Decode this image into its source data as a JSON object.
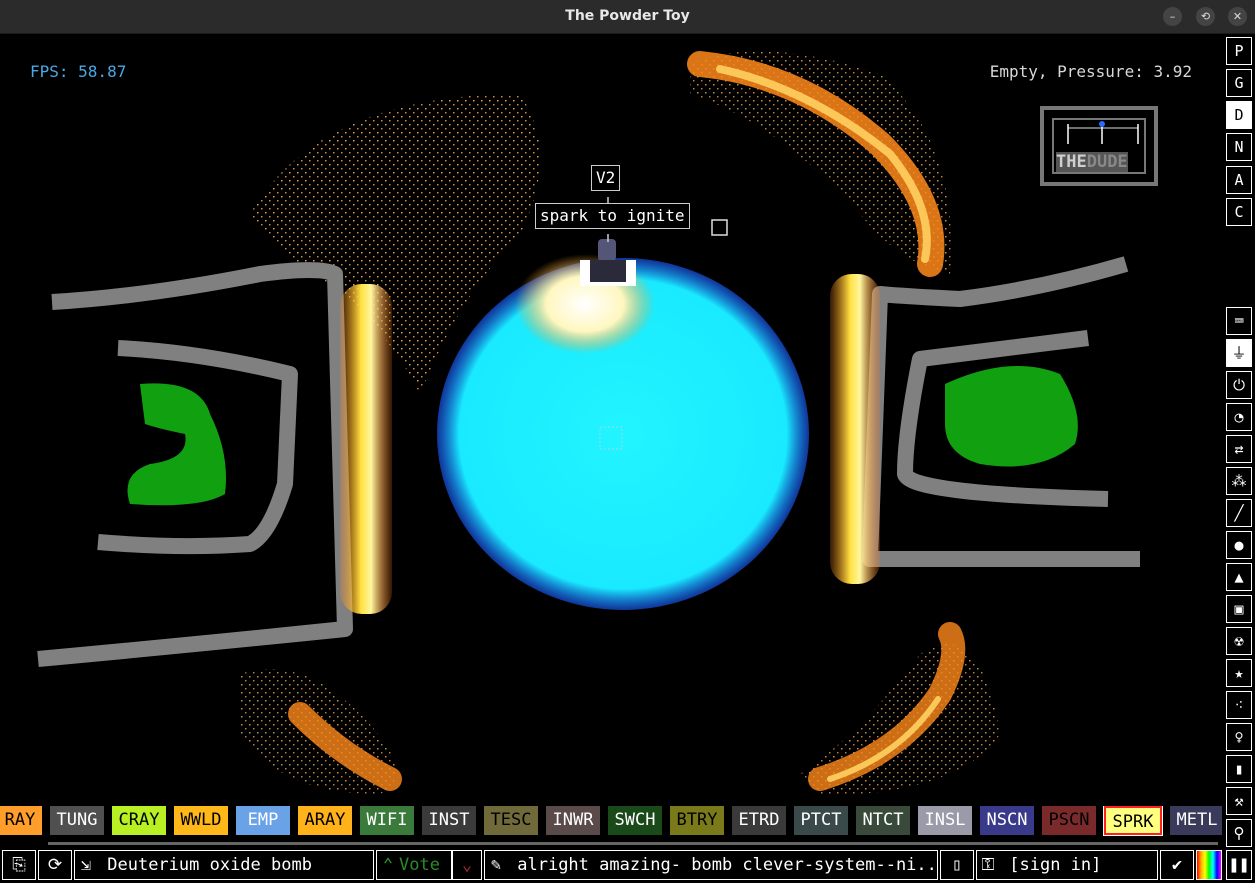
{
  "window": {
    "title": "The Powder Toy",
    "controls": [
      "–",
      "⟲",
      "✕"
    ]
  },
  "hud": {
    "fps": "FPS: 58.87",
    "pressure": "Empty, Pressure: 3.92"
  },
  "signs": {
    "version": "V2",
    "hint": "spark to ignite"
  },
  "stamp": {
    "text_left": "THE",
    "text_right": "DUDE"
  },
  "display_modes": [
    "P",
    "G",
    "D",
    "N",
    "A",
    "C"
  ],
  "display_modes_selected": "D",
  "category_icons": [
    "keyboard-icon",
    "plug-icon",
    "power-icon",
    "gauge-icon",
    "arrows-icon",
    "spray-icon",
    "pen-icon",
    "drop-icon",
    "flask-icon",
    "square-icon",
    "radiation-icon",
    "star-icon",
    "dots-icon",
    "bulb-icon",
    "bookmark-icon",
    "hammer-icon",
    "magnifier-icon"
  ],
  "category_selected": "plug-icon",
  "elements": [
    {
      "label": "RAY",
      "bg": "#ff9e2a",
      "fg": "#000000"
    },
    {
      "label": "TUNG",
      "bg": "#505050",
      "fg": "#ffffff"
    },
    {
      "label": "CRAY",
      "bg": "#b8f024",
      "fg": "#000000"
    },
    {
      "label": "WWLD",
      "bg": "#ffb81a",
      "fg": "#000000"
    },
    {
      "label": "EMP",
      "bg": "#6aa2e8",
      "fg": "#ffffff"
    },
    {
      "label": "ARAY",
      "bg": "#ffb21a",
      "fg": "#000000"
    },
    {
      "label": "WIFI",
      "bg": "#3a7a3a",
      "fg": "#ffffff"
    },
    {
      "label": "INST",
      "bg": "#3a3a3a",
      "fg": "#ffffff"
    },
    {
      "label": "TESC",
      "bg": "#706a3a",
      "fg": "#000000"
    },
    {
      "label": "INWR",
      "bg": "#5a4a4a",
      "fg": "#ffffff"
    },
    {
      "label": "SWCH",
      "bg": "#1a4a1a",
      "fg": "#ffffff"
    },
    {
      "label": "BTRY",
      "bg": "#7a7a1a",
      "fg": "#000000"
    },
    {
      "label": "ETRD",
      "bg": "#3a3a3a",
      "fg": "#ffffff"
    },
    {
      "label": "PTCT",
      "bg": "#3a4a4a",
      "fg": "#ffffff"
    },
    {
      "label": "NTCT",
      "bg": "#3a4a3a",
      "fg": "#ffffff"
    },
    {
      "label": "INSL",
      "bg": "#9a9aa8",
      "fg": "#ffffff"
    },
    {
      "label": "NSCN",
      "bg": "#3a3a8a",
      "fg": "#ffffff"
    },
    {
      "label": "PSCN",
      "bg": "#7a2a2a",
      "fg": "#000000"
    },
    {
      "label": "SPRK",
      "bg": "#ffff80",
      "fg": "#000000"
    },
    {
      "label": "METL",
      "bg": "#3a3a5a",
      "fg": "#ffffff"
    }
  ],
  "selected_element": "SPRK",
  "bottom": {
    "save_name": "Deuterium oxide bomb",
    "vote_label": "Vote",
    "tags": "alright amazing- bomb clever-system--ni...",
    "sign_in": "[sign in]"
  },
  "colors": {
    "accent_fps": "#4aa8e6",
    "wall": "#808080",
    "plant": "#10a010",
    "deut": "#19f0ff",
    "fire": "#ff9a1a"
  }
}
